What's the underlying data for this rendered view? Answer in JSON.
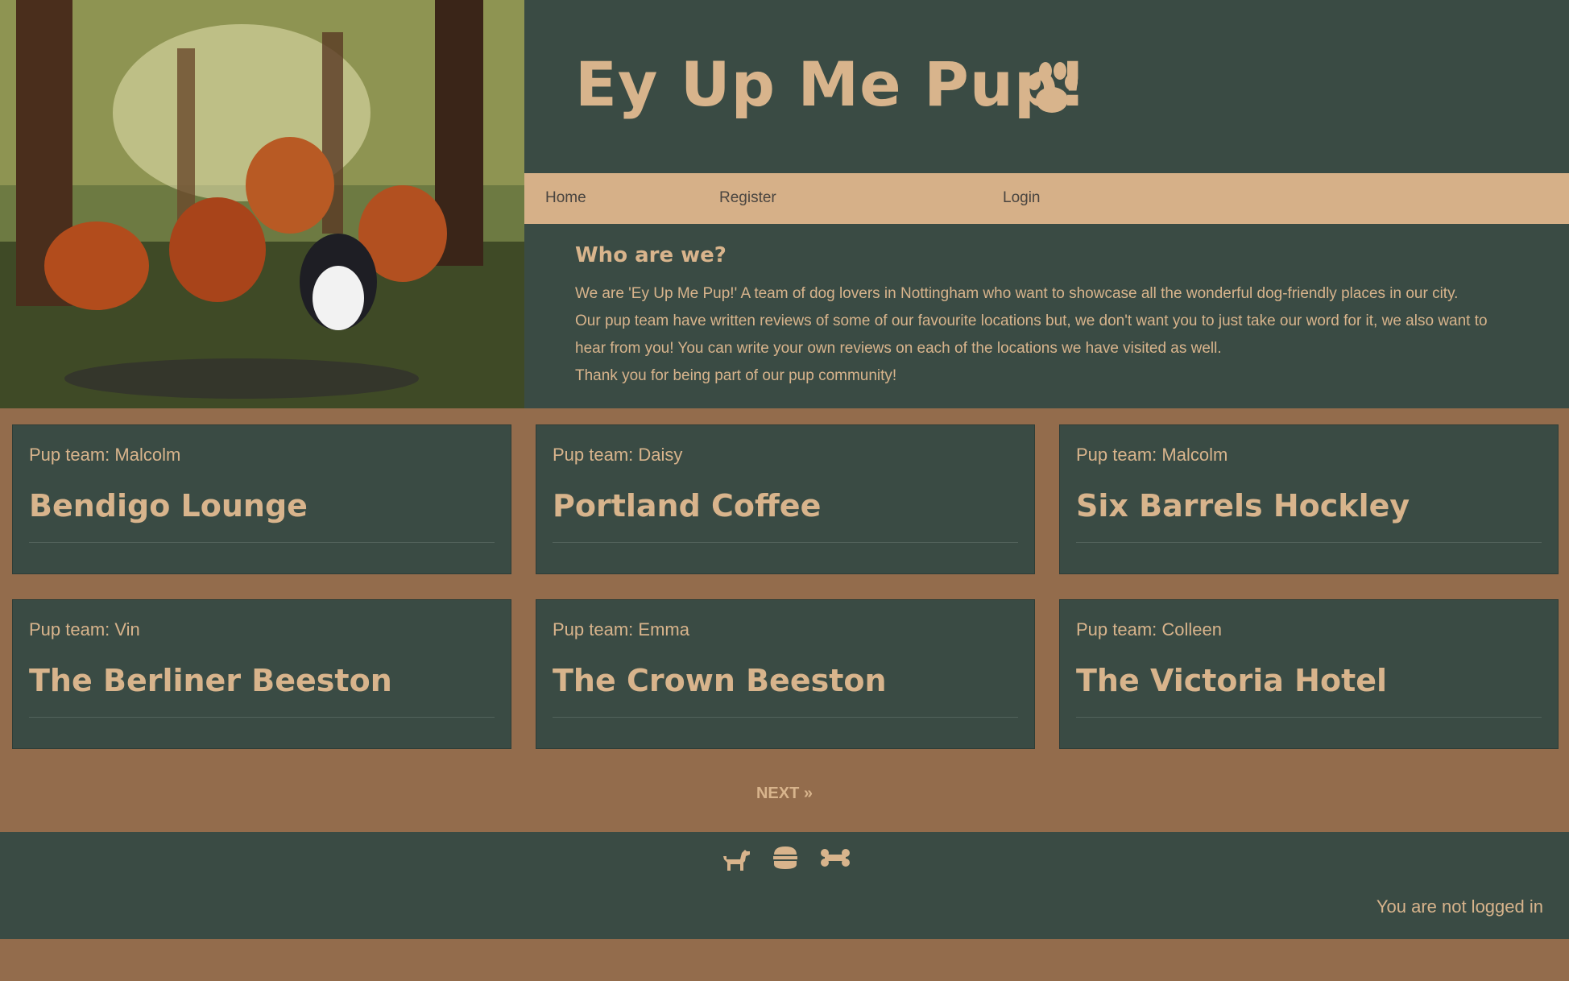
{
  "site": {
    "title": "Ey Up Me Pup!"
  },
  "nav": {
    "items": [
      {
        "label": "Home"
      },
      {
        "label": "Register"
      },
      {
        "label": "Login"
      }
    ]
  },
  "about": {
    "heading": "Who are we?",
    "paragraphs": [
      "We are 'Ey Up Me Pup!' A team of dog lovers in Nottingham who want to showcase all the wonderful dog-friendly places in our city.",
      "Our pup team have written reviews of some of our favourite locations but, we don't want you to just take our word for it, we also want to",
      "hear from you! You can write your own reviews on each of the locations we have visited as well.",
      "Thank you for being part of our pup community!"
    ]
  },
  "cards": [
    {
      "author": "Pup team: Malcolm",
      "title": "Bendigo Lounge"
    },
    {
      "author": "Pup team: Daisy",
      "title": "Portland Coffee"
    },
    {
      "author": "Pup team: Malcolm",
      "title": "Six Barrels Hockley"
    },
    {
      "author": "Pup team: Vin",
      "title": "The Berliner Beeston"
    },
    {
      "author": "Pup team: Emma",
      "title": "The Crown Beeston"
    },
    {
      "author": "Pup team: Colleen",
      "title": "The Victoria Hotel"
    }
  ],
  "pagination": {
    "next_label": "NEXT »"
  },
  "footer": {
    "icons": [
      "dog-icon",
      "burger-icon",
      "bone-icon"
    ],
    "login_status": "You are not logged in"
  },
  "colors": {
    "panel": "#3a4b44",
    "accent": "#d8b48c",
    "background": "#936c4c",
    "nav": "#d6b088"
  }
}
